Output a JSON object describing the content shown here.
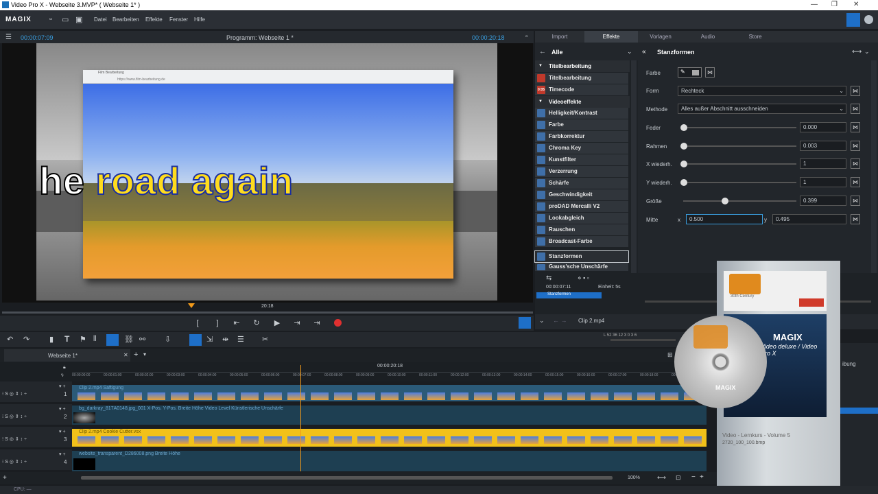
{
  "window": {
    "title": "Video Pro X - Webseite 3.MVP* ( Webseite 1* )"
  },
  "menu": {
    "logo": "MAGIX",
    "items": [
      "Datei",
      "Bearbeiten",
      "Effekte",
      "Fenster",
      "Hilfe"
    ]
  },
  "preview": {
    "timecode_left": "00:00:07:09",
    "title": "Programm: Webseite 1 *",
    "timecode_right": "00:00:20:18",
    "headline_white": "he",
    "headline_yellow": "road again",
    "scrub_label": "20:18",
    "browser_tab": "Film Bearbeitung",
    "browser_url": "https://www.film-bearbeitung.de"
  },
  "right_tabs": [
    "Import",
    "Effekte",
    "Vorlagen",
    "Audio",
    "Store"
  ],
  "effects": {
    "filter": "Alle",
    "categories": [
      {
        "label": "Titelbearbeitung",
        "items": [
          "Titelbearbeitung",
          "Timecode"
        ]
      },
      {
        "label": "Videoeffekte",
        "items": [
          "Helligkeit/Kontrast",
          "Farbe",
          "Farbkorrektur",
          "Chroma Key",
          "Kunstfilter",
          "Verzerrung",
          "Schärfe",
          "Geschwindigkeit",
          "proDAD Mercalli V2",
          "Lookabgleich",
          "Rauschen",
          "Broadcast-Farbe",
          "Stanzformen",
          "Gauss'sche Unschärfe"
        ]
      }
    ],
    "selected": "Stanzformen",
    "timecode_icon": "0:05"
  },
  "params": {
    "title": "Stanzformen",
    "farbe_label": "Farbe",
    "form_label": "Form",
    "form_value": "Rechteck",
    "methode_label": "Methode",
    "methode_value": "Alles außer Abschnitt ausschneiden",
    "feder_label": "Feder",
    "feder_value": "0.000",
    "rahmen_label": "Rahmen",
    "rahmen_value": "0.003",
    "xwied_label": "X wiederh.",
    "xwied_value": "1",
    "ywied_label": "Y wiederh.",
    "ywied_value": "1",
    "groesse_label": "Größe",
    "groesse_value": "0.399",
    "groesse_level": 0.37,
    "mitte_label": "Mitte",
    "mitte_x_label": "x",
    "mitte_x": "0.500",
    "mitte_y_label": "y",
    "mitte_y": "0.495"
  },
  "mini_timeline": {
    "timecode": "00:00:07:11",
    "unit_label": "Einheit: 5s",
    "track_label": "Stanzformen",
    "clip_label": "Clip 2.mp4"
  },
  "timeline": {
    "tab": "Webseite 1*",
    "center_time": "00:00:20:18",
    "ruler": [
      "00:00:00:00",
      "00:00:01:00",
      "00:00:02:00",
      "00:00:03:00",
      "00:00:04:00",
      "00:00:05:00",
      "00:00:06:00",
      "00:00:07:00",
      "00:00:08:00",
      "00:00:09:00",
      "00:00:10:00",
      "00:00:11:00",
      "00:00:12:00",
      "00:00:13:00",
      "00:00:14:00",
      "00:00:15:00",
      "00:00:16:00",
      "00:00:17:00",
      "00:00:18:00",
      "00:00:19:00"
    ],
    "tracks": [
      {
        "number": "1",
        "clip": "Clip 2.mp4   Saftigung"
      },
      {
        "number": "2",
        "clip": "bg_darkray_817A0148.jpg_001   X-Pos.   Y-Pos.   Breite   Höhe   Video Level   Künstlerische Unschärfe"
      },
      {
        "number": "3",
        "clip": "Clip 2.mp4   Cookie Cutter.vsx"
      },
      {
        "number": "4",
        "clip": "website_transparent_D286008.png   Breite   Höhe"
      }
    ],
    "zoom": "100%",
    "meter": "L 52 36 12 3 0 3 6",
    "side_label": "ibung"
  },
  "status": {
    "cpu": "CPU: —"
  },
  "product": {
    "badge": "30th Century",
    "brand": "MAGIX",
    "line": "Video deluxe / Video Pro X",
    "course": "Video - Lernkurs - Volume 5",
    "files": [
      "2720_100_100.bmp"
    ]
  }
}
